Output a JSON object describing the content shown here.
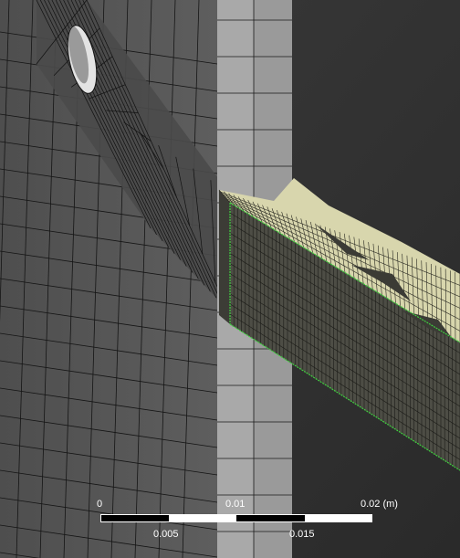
{
  "viewport": {
    "background_color": "#2f2f2f",
    "mesh_line_color": "#111111",
    "plate_face_color": "#5a5a5a",
    "post_face_color": "#9e9e9e",
    "post_side_color": "#b3b3b3",
    "beam_top_color": "#dedcb4",
    "beam_side_color": "#4b4b44",
    "edge_highlight_color": "#3fcf3f",
    "hole_color": "#e6e6e6"
  },
  "scale_bar": {
    "top_labels": [
      "0",
      "0.01",
      "0.02 (m)"
    ],
    "bottom_labels": [
      "0.005",
      "0.015"
    ]
  }
}
